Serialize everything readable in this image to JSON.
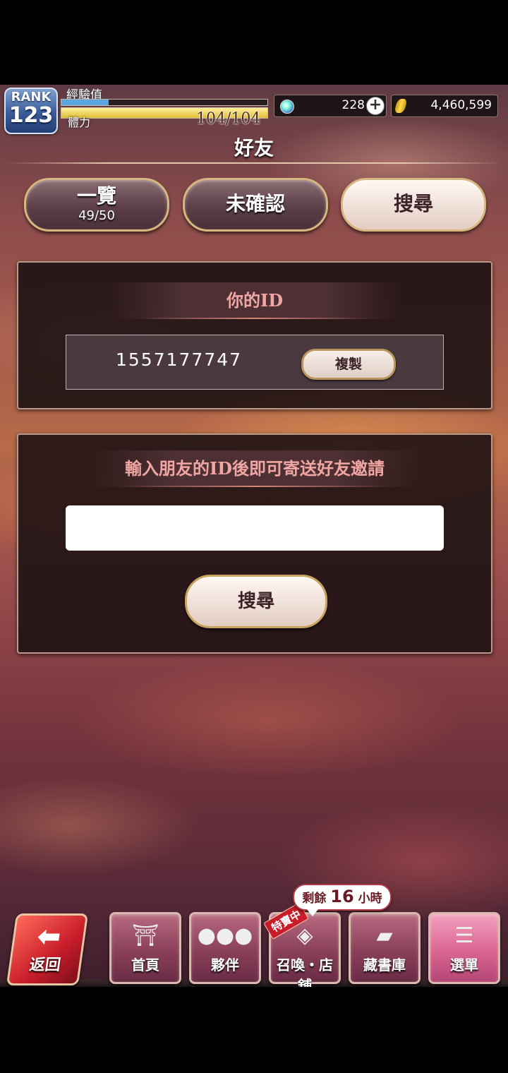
{
  "status_bar": {
    "rank_label": "RANK",
    "rank_value": "123",
    "exp_label": "經驗值",
    "exp_fraction": 0.23,
    "stamina_label": "體力",
    "stamina_value": "104/104",
    "stamina_fraction": 1.0,
    "gems": "228",
    "gold": "4,460,599"
  },
  "title": "好友",
  "tabs": {
    "list": {
      "label": "一覽",
      "count": "49/50"
    },
    "pending": {
      "label": "未確認"
    },
    "search": {
      "label": "搜尋",
      "active": true
    }
  },
  "my_id_panel": {
    "header": "你的ID",
    "id_value": "1557177747",
    "copy_label": "複製"
  },
  "invite_panel": {
    "header": "輸入朋友的ID後即可寄送好友邀請",
    "input_value": "",
    "search_label": "搜尋"
  },
  "bottom_nav": {
    "back_label": "返回",
    "home_label": "首頁",
    "companions_label": "夥伴",
    "summon_label": "召喚・店舖",
    "library_label": "藏書庫",
    "menu_label": "選單",
    "timer_prefix": "剩餘",
    "timer_value": "16",
    "timer_suffix": "小時",
    "sale_badge": "特賣中"
  },
  "colors": {
    "accent_pink": "#f0a7a3",
    "button_gold_border": "#c8a461",
    "back_red": "#c81c2a"
  },
  "icons": [
    "plus-icon",
    "gem-icon",
    "gold-coin-icon",
    "back-arrow-icon",
    "torii-gate-icon",
    "companions-icon",
    "crystal-ball-icon",
    "book-icon",
    "hamburger-menu-icon"
  ]
}
